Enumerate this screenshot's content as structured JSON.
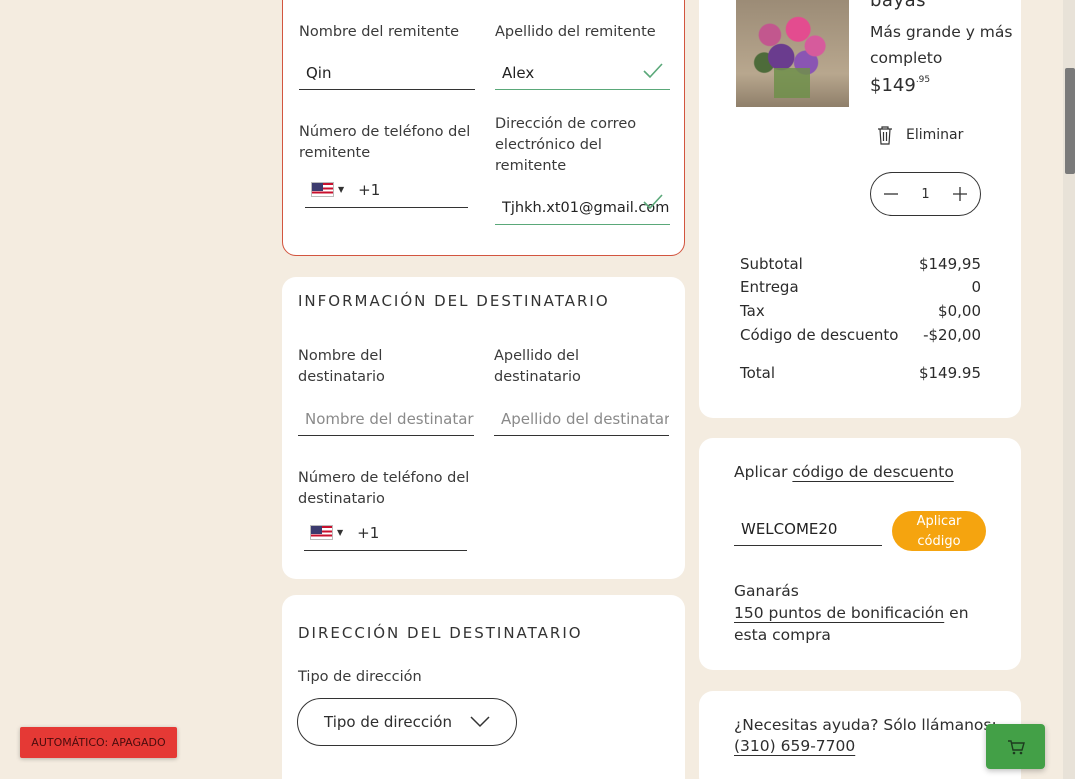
{
  "sender": {
    "first_name_label": "Nombre del remitente",
    "first_name_value": "Qin",
    "last_name_label": "Apellido del remitente",
    "last_name_value": "Alex",
    "phone_label": "Número de teléfono del remitente",
    "phone_code": "+1",
    "email_label": "Dirección de correo electrónico del remitente",
    "email_value": "Tjhkh.xt01@gmail.com"
  },
  "recipient": {
    "title": "INFORMACIÓN DEL DESTINATARIO",
    "first_name_label": "Nombre del destinatario",
    "first_name_placeholder": "Nombre del destinatario",
    "last_name_label": "Apellido del destinatario",
    "last_name_placeholder": "Apellido del destinatario",
    "phone_label": "Número de teléfono del destinatario",
    "phone_code": "+1"
  },
  "address": {
    "title": "DIRECCIÓN DEL DESTINATARIO",
    "type_label": "Tipo de dirección",
    "type_select": "Tipo de dirección"
  },
  "product": {
    "name_partial": "bayas",
    "size": "Más grande y más completo",
    "price_main": "$149",
    "price_cents": ".95",
    "remove_label": "Eliminar",
    "quantity": "1"
  },
  "summary": {
    "rows": [
      {
        "label": "Subtotal",
        "value": "$149,95"
      },
      {
        "label": "Entrega",
        "value": "0"
      },
      {
        "label": "Tax",
        "value": "$0,00"
      },
      {
        "label": "Código de descuento",
        "value": "-$20,00"
      }
    ],
    "total_label": "Total",
    "total_value": "$149.95"
  },
  "discount": {
    "apply_prefix": "Aplicar",
    "apply_link": "código de descuento",
    "code_value": "WELCOME20",
    "apply_button": "Aplicar código",
    "earn_prefix": "Ganarás",
    "earn_link": "150 puntos de bonificación",
    "earn_suffix": "en esta compra"
  },
  "help": {
    "text": "¿Necesitas ayuda? Sólo llámanos:",
    "phone": "(310) 659-7700"
  },
  "auto_badge": "AUTOMÁTICO: APAGADO",
  "colors": {
    "background": "#f4ece0",
    "error_border": "#d2553f",
    "valid": "#5aa879",
    "apply_button": "#f5a40f",
    "auto_badge": "#e53935",
    "cart_button": "#43a047"
  },
  "icons": [
    "checkmark-icon",
    "us-flag-icon",
    "trash-icon",
    "minus-icon",
    "plus-icon",
    "chevron-down-icon",
    "cart-icon"
  ]
}
